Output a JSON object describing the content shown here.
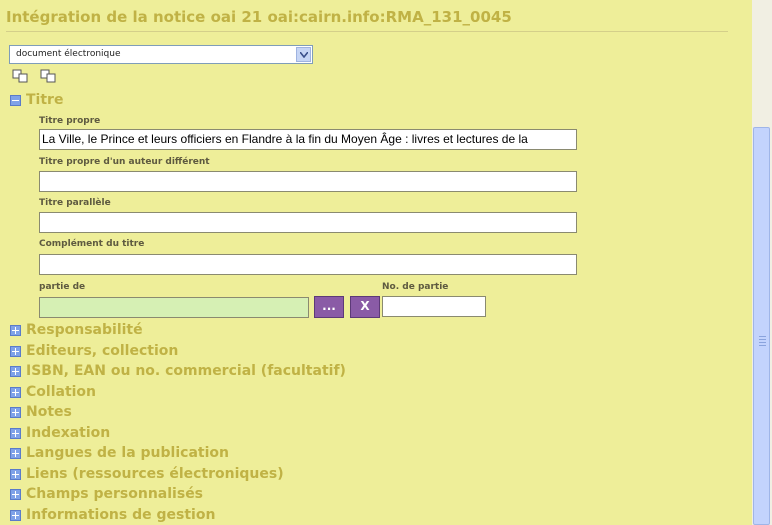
{
  "page": {
    "title": "Intégration de la notice oai 21 oai:cairn.info:RMA_131_0045"
  },
  "doctype": {
    "selected": "document électronique"
  },
  "icons": [
    "duplicate-icon",
    "duplicate-icon",
    "collapse-icon",
    "expand-icon",
    "search-icon"
  ],
  "titre_section": {
    "heading": "Titre",
    "fields": {
      "titre_propre_label": "Titre propre",
      "titre_propre_value": "La Ville, le Prince et leurs officiers en Flandre à la fin du Moyen Âge : livres et lectures de la",
      "titre_autre_auteur_label": "Titre propre d'un auteur différent",
      "titre_autre_auteur_value": "",
      "titre_parallele_label": "Titre parallèle",
      "titre_parallele_value": "",
      "complement_label": "Complément du titre",
      "complement_value": "",
      "partie_de_label": "partie de",
      "partie_de_value": "",
      "no_partie_label": "No. de partie",
      "no_partie_value": "",
      "browse_button": "...",
      "clear_button": "X"
    }
  },
  "sections": [
    "Responsabilité",
    "Editeurs, collection",
    "ISBN, EAN ou no. commercial (facultatif)",
    "Collation",
    "Notes",
    "Indexation",
    "Langues de la publication",
    "Liens (ressources électroniques)",
    "Champs personnalisés",
    "Informations de gestion"
  ],
  "colors": {
    "background": "#eeee99",
    "heading": "#c0b245",
    "button": "#8a5ba6"
  }
}
